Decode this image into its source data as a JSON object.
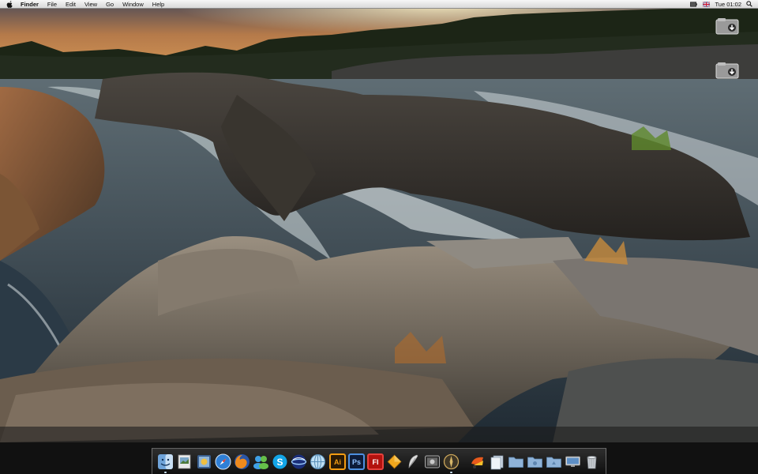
{
  "menubar": {
    "app_name": "Finder",
    "menus": [
      "File",
      "Edit",
      "View",
      "Go",
      "Window",
      "Help"
    ],
    "clock": "Tue 01:02"
  },
  "desktop": {
    "icons": [
      "drive-icon",
      "drive-icon"
    ]
  },
  "dock": {
    "items": [
      {
        "name": "finder",
        "label": ""
      },
      {
        "name": "preview",
        "label": ""
      },
      {
        "name": "photo-viewer",
        "label": ""
      },
      {
        "name": "safari",
        "label": ""
      },
      {
        "name": "firefox",
        "label": ""
      },
      {
        "name": "messenger",
        "label": ""
      },
      {
        "name": "skype",
        "label": ""
      },
      {
        "name": "globe-browser",
        "label": ""
      },
      {
        "name": "network-utility",
        "label": ""
      },
      {
        "name": "illustrator",
        "label": "Ai"
      },
      {
        "name": "photoshop",
        "label": "Ps"
      },
      {
        "name": "flash",
        "label": "Fl"
      },
      {
        "name": "sketch",
        "label": ""
      },
      {
        "name": "feather",
        "label": ""
      },
      {
        "name": "photo-booth",
        "label": ""
      },
      {
        "name": "compass",
        "label": ""
      },
      {
        "name": "transmit",
        "label": ""
      },
      {
        "name": "documents-stack",
        "label": ""
      },
      {
        "name": "folder",
        "label": ""
      },
      {
        "name": "folder",
        "label": ""
      },
      {
        "name": "folder",
        "label": ""
      },
      {
        "name": "display",
        "label": ""
      },
      {
        "name": "trash",
        "label": ""
      }
    ]
  },
  "colors": {
    "menubar": "#e6e6e6",
    "illustrator": "#f39c12",
    "photoshop": "#1f3f7a",
    "flash": "#b3120e"
  }
}
